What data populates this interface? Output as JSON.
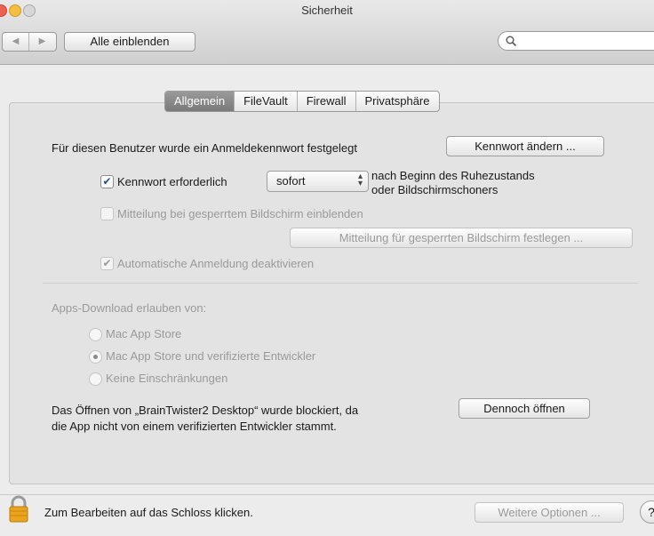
{
  "window": {
    "title": "Sicherheit"
  },
  "toolbar": {
    "show_all_label": "Alle einblenden",
    "search_placeholder": ""
  },
  "tabs": [
    {
      "label": "Allgemein",
      "active": true
    },
    {
      "label": "FileVault",
      "active": false
    },
    {
      "label": "Firewall",
      "active": false
    },
    {
      "label": "Privatsphäre",
      "active": false
    }
  ],
  "general": {
    "password_set_text": "Für diesen Benutzer wurde ein Anmeldekennwort festgelegt",
    "change_password_label": "Kennwort ändern ...",
    "require_password_label": "Kennwort erforderlich",
    "require_password_checked": true,
    "delay_value": "sofort",
    "after_sleep_line1": "nach Beginn des Ruhezustands",
    "after_sleep_line2": "oder Bildschirmschoners",
    "lock_message_label": "Mitteilung bei gesperrtem Bildschirm einblenden",
    "lock_message_checked": false,
    "set_lock_message_label": "Mitteilung für gesperrten Bildschirm festlegen ...",
    "disable_autologin_label": "Automatische Anmeldung deaktivieren",
    "disable_autologin_checked": true
  },
  "downloads": {
    "heading": "Apps-Download erlauben von:",
    "options": [
      {
        "label": "Mac App Store",
        "selected": false
      },
      {
        "label": "Mac App Store und verifizierte Entwickler",
        "selected": true
      },
      {
        "label": "Keine Einschränkungen",
        "selected": false
      }
    ],
    "blocked_line1": "Das Öffnen von „BrainTwister2 Desktop“ wurde blockiert, da",
    "blocked_line2": "die App nicht von einem verifizierten Entwickler stammt.",
    "open_anyway_label": "Dennoch öffnen"
  },
  "footer": {
    "lock_text": "Zum Bearbeiten auf das Schloss klicken.",
    "advanced_label": "Weitere Optionen ...",
    "help_label": "?"
  },
  "colors": {
    "close": "#ee5f55",
    "minimize": "#f4be42",
    "zoom": "#c9c9c9",
    "check": "#1f4f9a"
  }
}
